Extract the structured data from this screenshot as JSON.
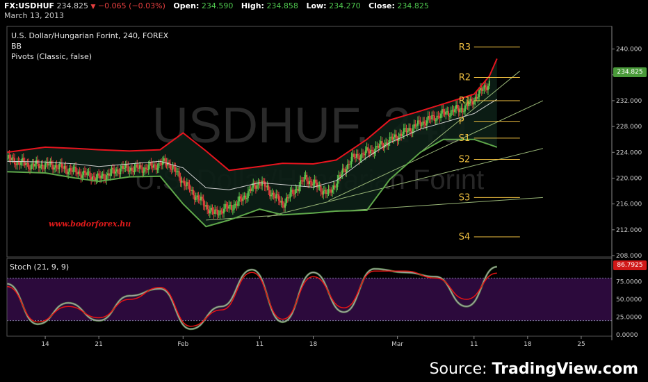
{
  "quote": {
    "symbol": "FX:USDHUF",
    "last": "234.825",
    "change": "−0.065 (−0.03%)",
    "open_label": "Open:",
    "open": "234.590",
    "high_label": "High:",
    "high": "234.858",
    "low_label": "Low:",
    "low": "234.270",
    "close_label": "Close:",
    "close": "234.825",
    "date": "March 13, 2013"
  },
  "legend": {
    "title": "U.S. Dollar/Hungarian Forint, 240, FOREX",
    "bb": "BB",
    "pivots": "Pivots (Classic, false)"
  },
  "watermark": {
    "big": "USDHUF, 240",
    "small": "U.S. Dollar/Hungarian Forint"
  },
  "stoch_label": "Stoch (21, 9, 9)",
  "website": "www.bodorforex.hu",
  "source": {
    "prefix": "Source: ",
    "brand": "TradingView.com"
  },
  "price_tag": "234.825",
  "stoch_tag": "86.7925",
  "colors": {
    "background": "#000000",
    "bb_band": "#e8141e",
    "bb_lower": "#5fa84a",
    "bb_mid": "#d0d0d0",
    "pivot": "#f0c040",
    "stoch_fill": "#2c0a3c",
    "stoch_k": "#a0a0a0",
    "stoch_d": "#e81414",
    "up_candle": "#5fc84f",
    "down_candle": "#e84040"
  },
  "chart_data": [
    {
      "type": "line",
      "subtype": "candlestick",
      "ylim": [
        208,
        242
      ],
      "y_ticks": [
        "208.000",
        "212.000",
        "216.000",
        "220.000",
        "224.000",
        "228.000",
        "232.000",
        "236.000",
        "240.000"
      ],
      "x_ticks": [
        "14",
        "21",
        "Feb",
        "11",
        "18",
        "Mar",
        "11",
        "18",
        "25"
      ],
      "x_tick_dates": [
        "2013-01-14",
        "2013-01-21",
        "2013-02-01",
        "2013-02-11",
        "2013-02-18",
        "2013-03-01",
        "2013-03-11",
        "2013-03-18",
        "2013-03-25"
      ],
      "x_range": [
        "2013-01-09",
        "2013-03-29"
      ],
      "series": [
        {
          "name": "BB",
          "dates": [
            "2013-01-09",
            "2013-01-14",
            "2013-01-18",
            "2013-01-21",
            "2013-01-25",
            "2013-01-29",
            "2013-02-01",
            "2013-02-04",
            "2013-02-07",
            "2013-02-11",
            "2013-02-14",
            "2013-02-18",
            "2013-02-21",
            "2013-02-25",
            "2013-02-28",
            "2013-03-04",
            "2013-03-07",
            "2013-03-11",
            "2013-03-13",
            "2013-03-14"
          ],
          "upper": [
            224.0,
            224.8,
            224.6,
            224.4,
            224.2,
            224.4,
            227.0,
            224.2,
            221.2,
            221.8,
            222.3,
            222.2,
            222.8,
            226.0,
            229.0,
            230.4,
            231.5,
            233.0,
            235.8,
            238.5
          ],
          "middle": [
            222.6,
            222.5,
            222.2,
            221.8,
            222.2,
            222.6,
            221.6,
            218.5,
            218.2,
            219.3,
            219.0,
            218.6,
            219.6,
            223.2,
            225.5,
            227.6,
            228.6,
            230.0,
            231.5,
            232.2
          ],
          "lower": [
            221.0,
            220.8,
            220.0,
            219.5,
            220.2,
            220.3,
            216.0,
            212.5,
            213.5,
            215.2,
            214.3,
            214.6,
            214.9,
            215.0,
            219.8,
            224.0,
            226.0,
            226.0,
            225.2,
            224.8
          ]
        },
        {
          "name": "Close",
          "dates": [
            "2013-01-09",
            "2013-01-12",
            "2013-01-15",
            "2013-01-18",
            "2013-01-21",
            "2013-01-24",
            "2013-01-27",
            "2013-01-30",
            "2013-02-02",
            "2013-02-05",
            "2013-02-08",
            "2013-02-11",
            "2013-02-14",
            "2013-02-17",
            "2013-02-20",
            "2013-02-23",
            "2013-02-26",
            "2013-03-01",
            "2013-03-04",
            "2013-03-07",
            "2013-03-10",
            "2013-03-13"
          ],
          "values": [
            223.0,
            222.0,
            222.0,
            221.0,
            220.0,
            221.5,
            221.5,
            222.5,
            218.0,
            214.5,
            216.0,
            219.5,
            216.0,
            220.0,
            217.5,
            223.0,
            224.5,
            226.5,
            228.5,
            230.0,
            231.0,
            234.825
          ]
        }
      ],
      "pivots": [
        {
          "label": "R3",
          "value": 240.3
        },
        {
          "label": "R2",
          "value": 235.6
        },
        {
          "label": "R1",
          "value": 232.0
        },
        {
          "label": "P",
          "value": 228.8
        },
        {
          "label": "S1",
          "value": 226.2
        },
        {
          "label": "S2",
          "value": 222.9
        },
        {
          "label": "S3",
          "value": 217.0
        },
        {
          "label": "S4",
          "value": 210.9
        }
      ],
      "trendlines": [
        {
          "from": [
            "2013-02-04",
            213.5
          ],
          "to": [
            "2013-03-20",
            217.0
          ]
        },
        {
          "from": [
            "2013-02-12",
            214.0
          ],
          "to": [
            "2013-03-20",
            224.6
          ]
        },
        {
          "from": [
            "2013-02-20",
            216.5
          ],
          "to": [
            "2013-03-20",
            232.0
          ]
        },
        {
          "from": [
            "2013-03-04",
            224.0
          ],
          "to": [
            "2013-03-17",
            236.6
          ]
        }
      ]
    },
    {
      "type": "line",
      "title": "Stoch (21, 9, 9)",
      "ylim": [
        0,
        100
      ],
      "y_ticks": [
        "0.0000",
        "25.0000",
        "50.0000",
        "75.0000"
      ],
      "bands": [
        20,
        80
      ],
      "series": [
        {
          "name": "%K",
          "dates": [
            "2013-01-09",
            "2013-01-13",
            "2013-01-17",
            "2013-01-21",
            "2013-01-25",
            "2013-01-29",
            "2013-02-02",
            "2013-02-06",
            "2013-02-10",
            "2013-02-14",
            "2013-02-18",
            "2013-02-22",
            "2013-02-26",
            "2013-03-02",
            "2013-03-06",
            "2013-03-10",
            "2013-03-14"
          ],
          "values": [
            72,
            15,
            45,
            20,
            55,
            65,
            8,
            40,
            92,
            18,
            88,
            32,
            93,
            88,
            82,
            40,
            96
          ]
        },
        {
          "name": "%D",
          "dates": [
            "2013-01-09",
            "2013-01-13",
            "2013-01-17",
            "2013-01-21",
            "2013-01-25",
            "2013-01-29",
            "2013-02-02",
            "2013-02-06",
            "2013-02-10",
            "2013-02-14",
            "2013-02-18",
            "2013-02-22",
            "2013-02-26",
            "2013-03-02",
            "2013-03-06",
            "2013-03-10",
            "2013-03-14"
          ],
          "values": [
            68,
            18,
            40,
            24,
            50,
            67,
            12,
            35,
            88,
            22,
            82,
            38,
            90,
            90,
            80,
            50,
            87
          ]
        }
      ]
    }
  ]
}
